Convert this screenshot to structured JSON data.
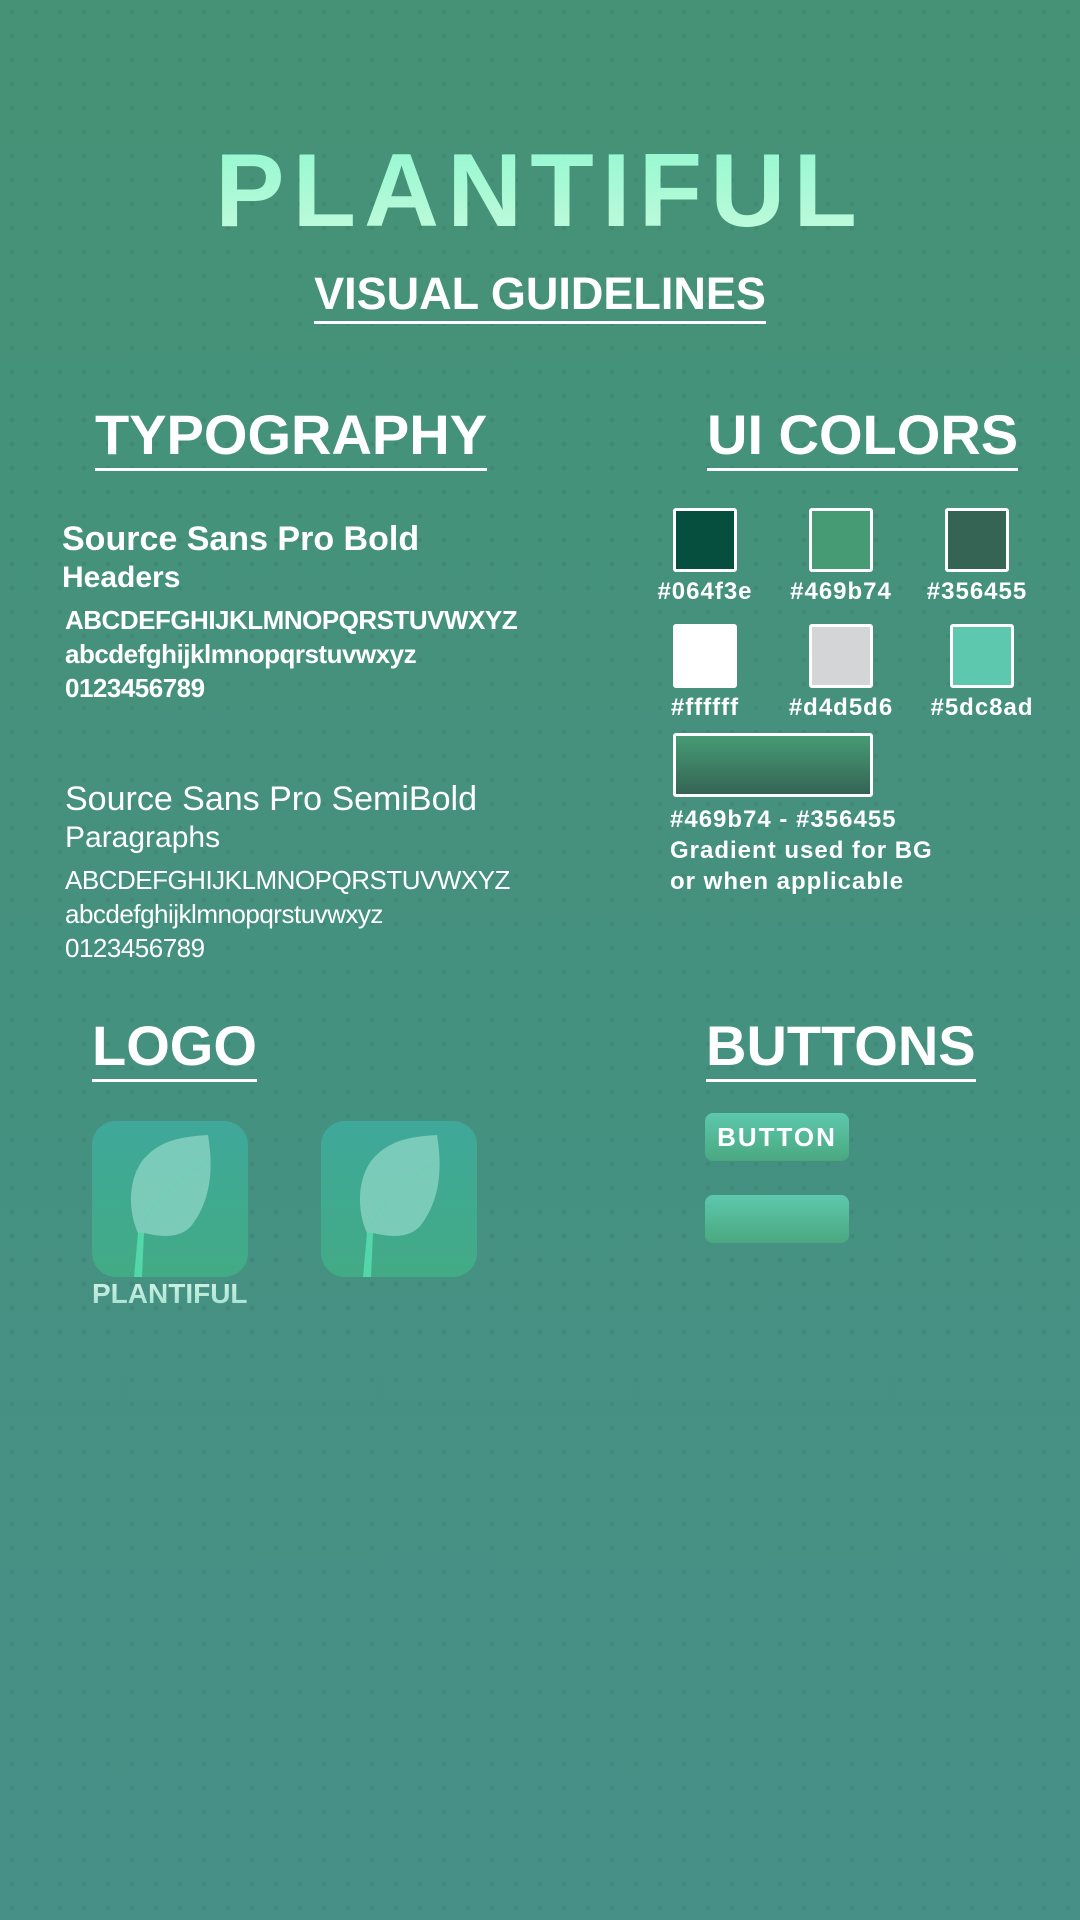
{
  "header": {
    "title": "PLANTIFUL",
    "subtitle": "VISUAL GUIDELINES"
  },
  "typography": {
    "heading": "TYPOGRAPHY",
    "fonts": [
      {
        "name": "Source Sans Pro Bold",
        "usage": "Headers",
        "upper": "ABCDEFGHIJKLMNOPQRSTUVWXYZ",
        "lower": "abcdefghijklmnopqrstuvwxyz",
        "digits": "0123456789"
      },
      {
        "name": "Source Sans Pro SemiBold",
        "usage": "Paragraphs",
        "upper": "ABCDEFGHIJKLMNOPQRSTUVWXYZ",
        "lower": "abcdefghijklmnopqrstuvwxyz",
        "digits": "0123456789"
      }
    ]
  },
  "colors": {
    "heading": "UI COLORS",
    "swatches": [
      {
        "label": "#064f3e",
        "color": "#064f3e"
      },
      {
        "label": "#469b74",
        "color": "#469b74"
      },
      {
        "label": "#356455",
        "color": "#356455"
      },
      {
        "label": "#ffffff",
        "color": "#ffffff"
      },
      {
        "label": "#d4d5d6",
        "color": "#d4d5d6"
      },
      {
        "label": "#5dc8ad",
        "color": "#5dc8ad"
      }
    ],
    "gradient": {
      "label": "#469b74 - #356455",
      "line2": "Gradient used for BG",
      "line3": "or when applicable"
    }
  },
  "logo": {
    "heading": "LOGO",
    "label": "PLANTIFUL",
    "icon": "leaf-icon"
  },
  "buttons": {
    "heading": "BUTTONS",
    "label": "BUTTON"
  }
}
